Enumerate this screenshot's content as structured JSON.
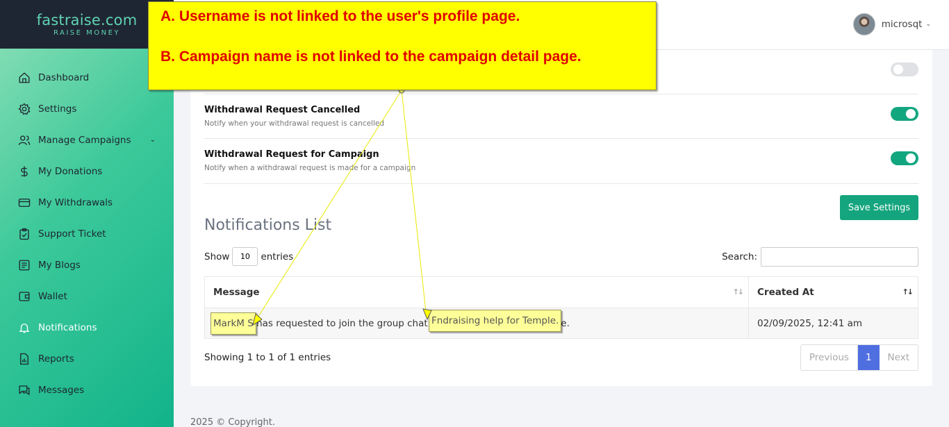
{
  "brand": {
    "name": "fastraise.com",
    "tagline": "RAISE MONEY"
  },
  "sidebar": {
    "items": [
      {
        "label": "Dashboard",
        "icon": "home-icon"
      },
      {
        "label": "Settings",
        "icon": "gear-icon"
      },
      {
        "label": "Manage Campaigns",
        "icon": "users-icon",
        "has_submenu": true
      },
      {
        "label": "My Donations",
        "icon": "dollar-icon"
      },
      {
        "label": "My Withdrawals",
        "icon": "credit-card-icon"
      },
      {
        "label": "Support Ticket",
        "icon": "clipboard-check-icon"
      },
      {
        "label": "My Blogs",
        "icon": "document-icon"
      },
      {
        "label": "Wallet",
        "icon": "wallet-icon"
      },
      {
        "label": "Notifications",
        "icon": "bell-icon",
        "active": true
      },
      {
        "label": "Reports",
        "icon": "report-icon"
      },
      {
        "label": "Messages",
        "icon": "chat-icon"
      }
    ],
    "active_color": "#ffffff"
  },
  "header": {
    "user_name": "microsqt"
  },
  "settings": [
    {
      "title": "",
      "desc": "",
      "enabled": false
    },
    {
      "title": "Withdrawal Request Cancelled",
      "desc": "Notify when your withdrawal request is cancelled",
      "enabled": true
    },
    {
      "title": "Withdrawal Request for Campaign",
      "desc": "Notify when a withdrawal request is made for a campaign",
      "enabled": true
    }
  ],
  "save_label": "Save Settings",
  "list": {
    "title": "Notifications List",
    "show_label": "Show",
    "entries_value": "10",
    "entries_label": "entries",
    "search_label": "Search:",
    "columns": [
      "Message",
      "Created At"
    ],
    "rows": [
      {
        "message": "MarkM S has requested to join the group chat in Fndraising help for Temple.",
        "created_at": "02/09/2025, 12:41 am"
      }
    ],
    "info": "Showing 1 to 1 of 1 entries",
    "pager": {
      "prev": "Previous",
      "page": "1",
      "next": "Next"
    }
  },
  "footer": "2025 © Copyright.",
  "annotation": {
    "line_a": "A. Username is not linked to the user's profile page.",
    "line_b": "B. Campaign name is not linked to the campaign detail page.",
    "tag_user": "MarkM S",
    "tag_campaign": "Fndraising help for Temple."
  },
  "colors": {
    "accent": "#14a57e",
    "pager_active": "#4f6ee0",
    "callout": "#ffff00",
    "callout_text": "#e00000"
  }
}
